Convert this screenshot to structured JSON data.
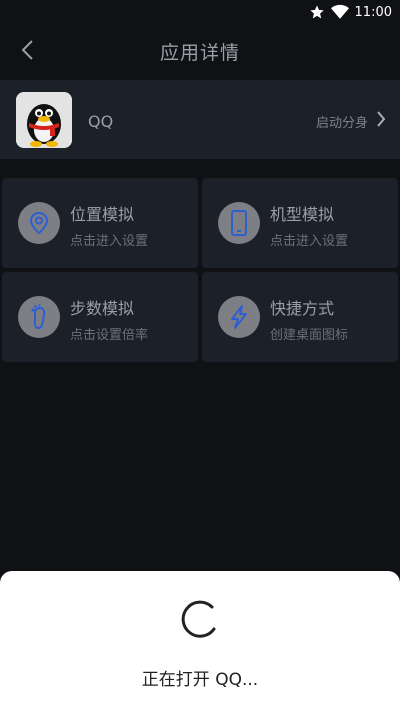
{
  "status_bar": {
    "time": "11:00",
    "icons": [
      "star-icon",
      "wifi-icon"
    ]
  },
  "header": {
    "title": "应用详情",
    "back_icon": "chevron-left-icon"
  },
  "app": {
    "name": "QQ",
    "icon": "qq-penguin-icon",
    "action_label": "启动分身",
    "action_icon": "chevron-right-icon"
  },
  "features": [
    {
      "title": "位置模拟",
      "subtitle": "点击进入设置",
      "icon": "location-pin-icon"
    },
    {
      "title": "机型模拟",
      "subtitle": "点击进入设置",
      "icon": "phone-icon"
    },
    {
      "title": "步数模拟",
      "subtitle": "点击设置倍率",
      "icon": "footprint-icon"
    },
    {
      "title": "快捷方式",
      "subtitle": "创建桌面图标",
      "icon": "lightning-icon"
    }
  ],
  "loading_sheet": {
    "text": "正在打开 QQ...",
    "icon": "spinner-icon"
  },
  "colors": {
    "background": "#101114",
    "card": "#1b2029",
    "icon_circle": "#7d7f84",
    "icon_accent": "#2d5fd3",
    "sheet": "#ffffff"
  }
}
